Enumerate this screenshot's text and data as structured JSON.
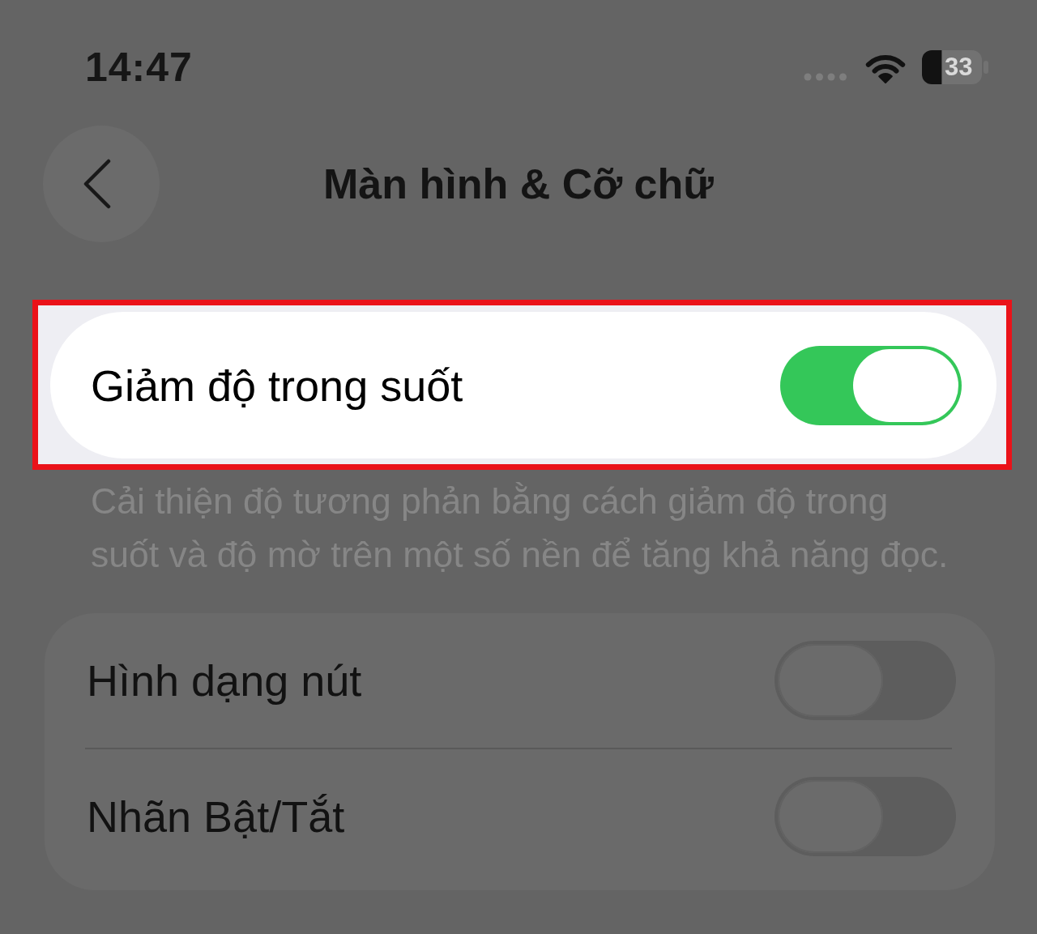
{
  "status_bar": {
    "time": "14:47",
    "battery": "33"
  },
  "header": {
    "title": "Màn hình & Cỡ chữ"
  },
  "groups": [
    {
      "highlighted": true,
      "items": [
        {
          "label": "Giảm độ trong suốt",
          "on": true
        }
      ],
      "footer": "Cải thiện độ tương phản bằng cách giảm độ trong suốt và độ mờ trên một số nền để tăng khả năng đọc."
    },
    {
      "highlighted": false,
      "items": [
        {
          "label": "Hình dạng nút",
          "on": false
        },
        {
          "label": "Nhãn Bật/Tắt",
          "on": false
        }
      ]
    }
  ]
}
